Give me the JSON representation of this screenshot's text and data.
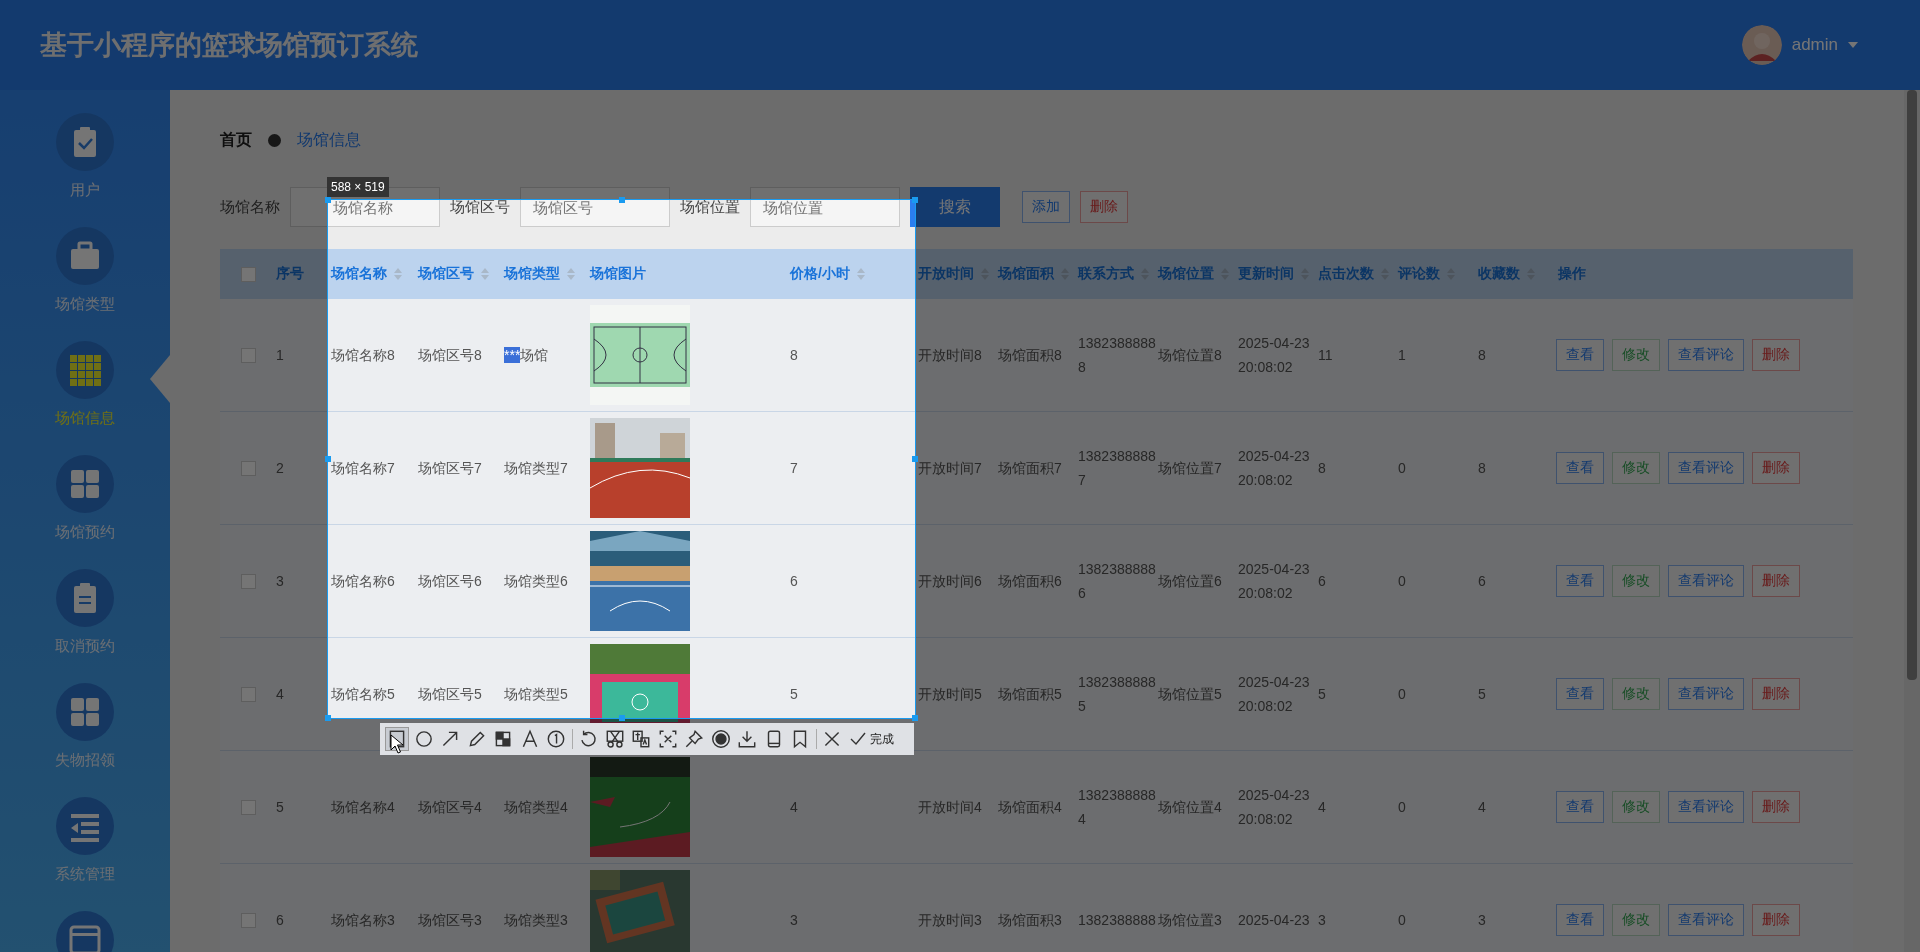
{
  "header": {
    "title": "基于小程序的篮球场馆预订系统",
    "user": "admin"
  },
  "sidebar": {
    "items": [
      {
        "label": "用户",
        "kind": "clipboard-check",
        "selected": false
      },
      {
        "label": "场馆类型",
        "kind": "briefcase",
        "selected": false
      },
      {
        "label": "场馆信息",
        "kind": "grid9",
        "selected": true
      },
      {
        "label": "场馆预约",
        "kind": "grid4",
        "selected": false
      },
      {
        "label": "取消预约",
        "kind": "clipboard",
        "selected": false
      },
      {
        "label": "失物招领",
        "kind": "grid4",
        "selected": false
      },
      {
        "label": "系统管理",
        "kind": "list",
        "selected": false
      },
      {
        "kind": "window",
        "selected": false
      }
    ]
  },
  "breadcrumb": [
    "首页",
    "场馆信息"
  ],
  "search": {
    "fields": [
      {
        "label": "场馆名称",
        "placeholder": "场馆名称"
      },
      {
        "label": "场馆区号",
        "placeholder": "场馆区号"
      },
      {
        "label": "场馆位置",
        "placeholder": "场馆位置"
      }
    ],
    "button": "搜索",
    "actions": [
      {
        "label": "添加",
        "kind": "add"
      },
      {
        "label": "删除",
        "kind": "delete"
      }
    ]
  },
  "table": {
    "select_all": {
      "checked": false
    },
    "columns": [
      {
        "label": "序号",
        "sortable": false
      },
      {
        "label": "场馆名称",
        "sortable": true
      },
      {
        "label": "场馆区号",
        "sortable": true
      },
      {
        "label": "场馆类型",
        "sortable": true
      },
      {
        "label": "场馆图片",
        "sortable": false
      },
      {
        "label": "价格/小时",
        "sortable": true
      },
      {
        "label": "开放时间",
        "sortable": true
      },
      {
        "label": "场馆面积",
        "sortable": true
      },
      {
        "label": "联系方式",
        "sortable": true
      },
      {
        "label": "场馆位置",
        "sortable": true
      },
      {
        "label": "更新时间",
        "sortable": true
      },
      {
        "label": "点击次数",
        "sortable": true
      },
      {
        "label": "评论数",
        "sortable": true
      },
      {
        "label": "收藏数",
        "sortable": true
      },
      {
        "label": "操作",
        "sortable": false
      }
    ],
    "rows": [
      {
        "checked": false,
        "cells": [
          "1",
          "场馆名称8",
          "场馆区号8",
          "场馆",
          "",
          "8",
          "开放时间8",
          "场馆面积8",
          "13823888888",
          "场馆位置8",
          "2025-04-23 20:08:02",
          "11",
          "1",
          "8"
        ],
        "highlight": "***",
        "picture": {
          "kind": "picture"
        },
        "actions": [
          {
            "label": "查看",
            "kind": "view"
          },
          {
            "label": "修改",
            "kind": "edit"
          },
          {
            "label": "查看评论",
            "kind": "view"
          },
          {
            "label": "删除",
            "kind": "delete"
          }
        ]
      },
      {
        "checked": false,
        "cells": [
          "2",
          "场馆名称7",
          "场馆区号7",
          "场馆类型7",
          "",
          "7",
          "开放时间7",
          "场馆面积7",
          "13823888887",
          "场馆位置7",
          "2025-04-23 20:08:02",
          "8",
          "0",
          "8"
        ],
        "picture": {
          "kind": "picture"
        },
        "actions": [
          {
            "label": "查看",
            "kind": "view"
          },
          {
            "label": "修改",
            "kind": "edit"
          },
          {
            "label": "查看评论",
            "kind": "view"
          },
          {
            "label": "删除",
            "kind": "delete"
          }
        ]
      },
      {
        "checked": false,
        "cells": [
          "3",
          "场馆名称6",
          "场馆区号6",
          "场馆类型6",
          "",
          "6",
          "开放时间6",
          "场馆面积6",
          "13823888886",
          "场馆位置6",
          "2025-04-23 20:08:02",
          "6",
          "0",
          "6"
        ],
        "picture": {
          "kind": "picture"
        },
        "actions": [
          {
            "label": "查看",
            "kind": "view"
          },
          {
            "label": "修改",
            "kind": "edit"
          },
          {
            "label": "查看评论",
            "kind": "view"
          },
          {
            "label": "删除",
            "kind": "delete"
          }
        ]
      },
      {
        "checked": false,
        "cells": [
          "4",
          "场馆名称5",
          "场馆区号5",
          "场馆类型5",
          "",
          "5",
          "开放时间5",
          "场馆面积5",
          "13823888885",
          "场馆位置5",
          "2025-04-23 20:08:02",
          "5",
          "0",
          "5"
        ],
        "picture": {
          "kind": "picture"
        },
        "actions": [
          {
            "label": "查看",
            "kind": "view"
          },
          {
            "label": "修改",
            "kind": "edit"
          },
          {
            "label": "查看评论",
            "kind": "view"
          },
          {
            "label": "删除",
            "kind": "delete"
          }
        ]
      },
      {
        "checked": false,
        "cells": [
          "5",
          "场馆名称4",
          "场馆区号4",
          "场馆类型4",
          "",
          "4",
          "开放时间4",
          "场馆面积4",
          "13823888884",
          "场馆位置4",
          "2025-04-23 20:08:02",
          "4",
          "0",
          "4"
        ],
        "picture": {
          "kind": "picture"
        },
        "actions": [
          {
            "label": "查看",
            "kind": "view"
          },
          {
            "label": "修改",
            "kind": "edit"
          },
          {
            "label": "查看评论",
            "kind": "view"
          },
          {
            "label": "删除",
            "kind": "delete"
          }
        ]
      },
      {
        "checked": false,
        "cells": [
          "6",
          "场馆名称3",
          "场馆区号3",
          "场馆类型3",
          "",
          "3",
          "开放时间3",
          "场馆面积3",
          "1382388888",
          "场馆位置3",
          "2025-04-23",
          "3",
          "0",
          "3"
        ],
        "picture": {
          "kind": "picture"
        },
        "actions": [
          {
            "label": "查看",
            "kind": "view"
          },
          {
            "label": "修改",
            "kind": "edit"
          },
          {
            "label": "查看评论",
            "kind": "view"
          },
          {
            "label": "删除",
            "kind": "delete"
          }
        ]
      }
    ]
  },
  "capture": {
    "size_label": "588 × 519",
    "tools": [
      {
        "kind": "rectangle",
        "selected": true
      },
      {
        "kind": "ellipse",
        "selected": false
      },
      {
        "kind": "arrow",
        "selected": false
      },
      {
        "kind": "pencil",
        "selected": false
      },
      {
        "kind": "mosaic",
        "selected": false
      },
      {
        "kind": "text",
        "selected": false
      },
      {
        "kind": "number",
        "selected": false
      },
      {
        "kind": "undo",
        "selected": false
      },
      {
        "kind": "cut",
        "selected": false
      },
      {
        "kind": "translate",
        "selected": false
      },
      {
        "kind": "ocr",
        "selected": false
      },
      {
        "kind": "pin",
        "selected": false
      },
      {
        "kind": "record",
        "selected": false
      },
      {
        "kind": "download",
        "selected": false
      },
      {
        "kind": "phone",
        "selected": false
      },
      {
        "kind": "bookmark",
        "selected": false
      },
      {
        "kind": "close",
        "selected": false
      }
    ],
    "done": "完成"
  }
}
